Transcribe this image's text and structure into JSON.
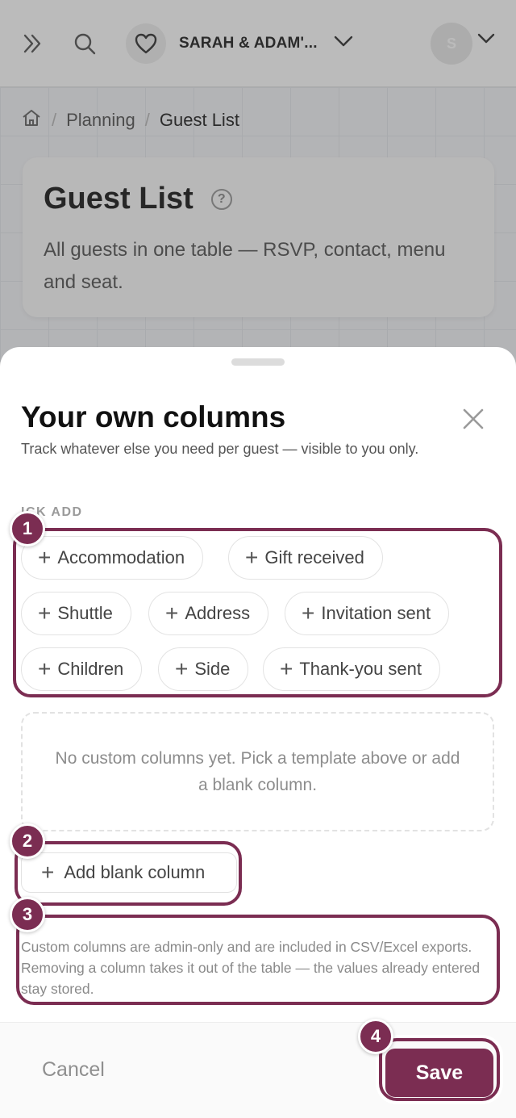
{
  "header": {
    "event_name": "SARAH & ADAM'...",
    "avatar_initial": "S"
  },
  "breadcrumb": {
    "items": [
      "Planning",
      "Guest List"
    ]
  },
  "page": {
    "title": "Guest List",
    "help": "?",
    "description": "All guests in one table — RSVP, contact, menu and seat."
  },
  "sheet": {
    "title": "Your own columns",
    "subtitle": "Track whatever else you need per guest — visible to you only.",
    "quick_add_label": "ICK ADD",
    "chips": [
      {
        "plus": "+",
        "label": "Accommodation"
      },
      {
        "plus": "+",
        "label": "Gift received"
      },
      {
        "plus": "+",
        "label": "Shuttle"
      },
      {
        "plus": "+",
        "label": "Address"
      },
      {
        "plus": "+",
        "label": "Invitation sent"
      },
      {
        "plus": "+",
        "label": "Children"
      },
      {
        "plus": "+",
        "label": "Side"
      },
      {
        "plus": "+",
        "label": "Thank-you sent"
      }
    ],
    "empty_text": "No custom columns yet. Pick a template above or add a blank column.",
    "add_blank_plus": "+",
    "add_blank_label": "Add blank column",
    "note": "Custom columns are admin-only and are included in CSV/Excel exports. Removing a column takes it out of the table — the values already entered stay stored.",
    "cancel_label": "Cancel",
    "save_label": "Save"
  },
  "tutorial_badges": [
    "1",
    "2",
    "3",
    "4"
  ],
  "colors": {
    "accent": "#7b2d52"
  }
}
